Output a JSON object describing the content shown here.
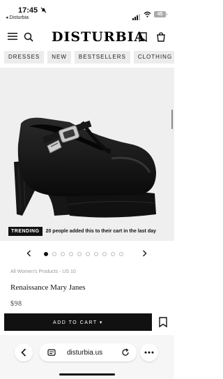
{
  "status": {
    "time": "17:45",
    "back_app": "◂ Disturbia",
    "battery": "45"
  },
  "header": {
    "logo": "DISTURBIA"
  },
  "categories": [
    "DRESSES",
    "NEW",
    "BESTSELLERS",
    "CLOTHING"
  ],
  "trending": {
    "tag": "TRENDING",
    "text": "20 people added this to their cart in the last day"
  },
  "carousel": {
    "total": 10,
    "active": 0
  },
  "product": {
    "breadcrumb": "All Women's Products - US 10",
    "name": "Renaissance Mary Janes",
    "price": "$98",
    "add_to_cart": "ADD TO CART ▾"
  },
  "browser": {
    "url": "disturbia.us"
  }
}
